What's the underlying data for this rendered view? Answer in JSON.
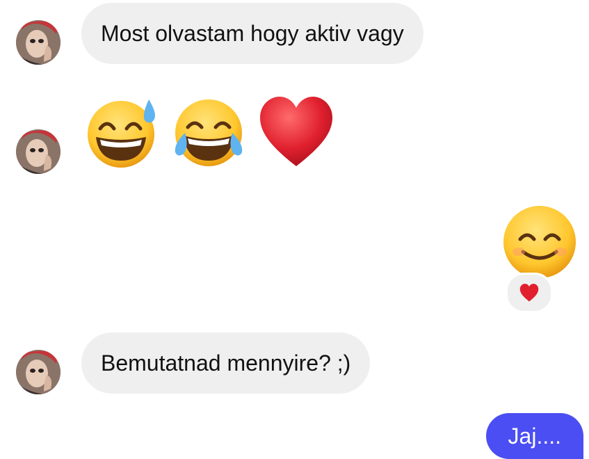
{
  "conversation": {
    "messages": [
      {
        "sender": "incoming",
        "type": "text",
        "text": "Most olvastam hogy aktiv vagy"
      },
      {
        "sender": "incoming",
        "type": "emoji",
        "emoji": [
          "grinning-face-with-sweat",
          "face-with-tears-of-joy",
          "red-heart"
        ]
      },
      {
        "sender": "outgoing",
        "type": "emoji",
        "emoji": [
          "smiling-face-with-smiling-eyes"
        ],
        "reaction": "red-heart"
      },
      {
        "sender": "incoming",
        "type": "text",
        "text": "Bemutatnad mennyire? ;)"
      },
      {
        "sender": "outgoing",
        "type": "text",
        "text": "Jaj...."
      }
    ]
  },
  "colors": {
    "incoming_bubble": "#efefef",
    "outgoing_bubble": "#4b4ef2",
    "heart": "#e0202e",
    "emoji_yellow": "#ffcc33"
  }
}
